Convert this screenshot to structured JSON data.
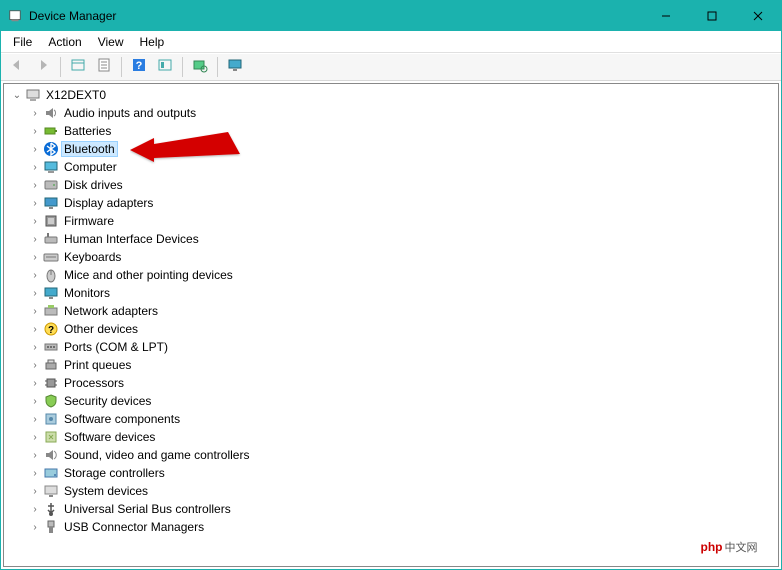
{
  "window": {
    "title": "Device Manager"
  },
  "menubar": {
    "items": [
      {
        "label": "File"
      },
      {
        "label": "Action"
      },
      {
        "label": "View"
      },
      {
        "label": "Help"
      }
    ]
  },
  "toolbar": {
    "buttons": [
      {
        "name": "back-button",
        "icon": "arrow-left-icon",
        "disabled": true
      },
      {
        "name": "forward-button",
        "icon": "arrow-right-icon",
        "disabled": true
      },
      {
        "name": "sep"
      },
      {
        "name": "show-hide-button",
        "icon": "panel-icon"
      },
      {
        "name": "properties-button",
        "icon": "properties-icon"
      },
      {
        "name": "sep"
      },
      {
        "name": "help-button",
        "icon": "help-icon"
      },
      {
        "name": "action-button",
        "icon": "action-icon"
      },
      {
        "name": "sep"
      },
      {
        "name": "scan-hardware-button",
        "icon": "scan-icon"
      },
      {
        "name": "sep"
      },
      {
        "name": "add-hardware-button",
        "icon": "monitor-icon"
      }
    ]
  },
  "tree": {
    "root": {
      "label": "X12DEXT0",
      "icon": "computer-root-icon",
      "expanded": true
    },
    "items": [
      {
        "label": "Audio inputs and outputs",
        "icon": "audio-icon"
      },
      {
        "label": "Batteries",
        "icon": "battery-icon"
      },
      {
        "label": "Bluetooth",
        "icon": "bluetooth-icon",
        "selected": true
      },
      {
        "label": "Computer",
        "icon": "computer-icon"
      },
      {
        "label": "Disk drives",
        "icon": "disk-icon"
      },
      {
        "label": "Display adapters",
        "icon": "display-icon"
      },
      {
        "label": "Firmware",
        "icon": "firmware-icon"
      },
      {
        "label": "Human Interface Devices",
        "icon": "hid-icon"
      },
      {
        "label": "Keyboards",
        "icon": "keyboard-icon"
      },
      {
        "label": "Mice and other pointing devices",
        "icon": "mouse-icon"
      },
      {
        "label": "Monitors",
        "icon": "monitor-icon"
      },
      {
        "label": "Network adapters",
        "icon": "network-icon"
      },
      {
        "label": "Other devices",
        "icon": "other-icon"
      },
      {
        "label": "Ports (COM & LPT)",
        "icon": "port-icon"
      },
      {
        "label": "Print queues",
        "icon": "printer-icon"
      },
      {
        "label": "Processors",
        "icon": "cpu-icon"
      },
      {
        "label": "Security devices",
        "icon": "security-icon"
      },
      {
        "label": "Software components",
        "icon": "software-comp-icon"
      },
      {
        "label": "Software devices",
        "icon": "software-dev-icon"
      },
      {
        "label": "Sound, video and game controllers",
        "icon": "sound-icon"
      },
      {
        "label": "Storage controllers",
        "icon": "storage-icon"
      },
      {
        "label": "System devices",
        "icon": "system-icon"
      },
      {
        "label": "Universal Serial Bus controllers",
        "icon": "usb-icon"
      },
      {
        "label": "USB Connector Managers",
        "icon": "usb-conn-icon"
      }
    ]
  },
  "annotation": {
    "type": "red-arrow",
    "target": "Bluetooth"
  },
  "watermark": {
    "brand": "php",
    "suffix": "中文网"
  }
}
